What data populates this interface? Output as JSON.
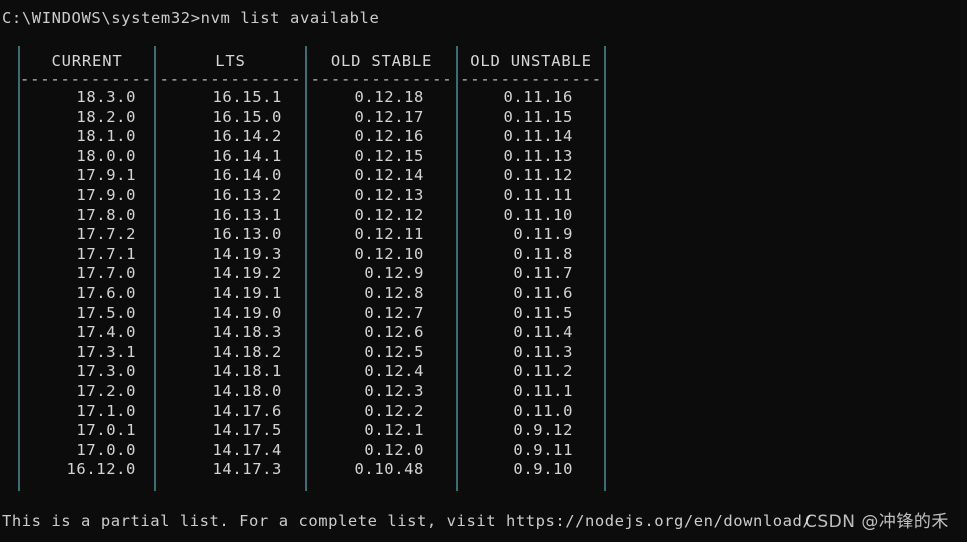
{
  "terminal": {
    "background_color": "#0c0c0c",
    "foreground_color": "#cccccc",
    "border_color": "#3a6e73",
    "prompt_line": "C:\\WINDOWS\\system32>nvm list available",
    "footer_line": "This is a partial list. For a complete list, visit https://nodejs.org/en/download/"
  },
  "table": {
    "headers": [
      "CURRENT",
      "LTS",
      "OLD STABLE",
      "OLD UNSTABLE"
    ],
    "separator": "--------------",
    "rows": [
      [
        "18.3.0",
        "16.15.1",
        "0.12.18",
        "0.11.16"
      ],
      [
        "18.2.0",
        "16.15.0",
        "0.12.17",
        "0.11.15"
      ],
      [
        "18.1.0",
        "16.14.2",
        "0.12.16",
        "0.11.14"
      ],
      [
        "18.0.0",
        "16.14.1",
        "0.12.15",
        "0.11.13"
      ],
      [
        "17.9.1",
        "16.14.0",
        "0.12.14",
        "0.11.12"
      ],
      [
        "17.9.0",
        "16.13.2",
        "0.12.13",
        "0.11.11"
      ],
      [
        "17.8.0",
        "16.13.1",
        "0.12.12",
        "0.11.10"
      ],
      [
        "17.7.2",
        "16.13.0",
        "0.12.11",
        "0.11.9"
      ],
      [
        "17.7.1",
        "14.19.3",
        "0.12.10",
        "0.11.8"
      ],
      [
        "17.7.0",
        "14.19.2",
        "0.12.9",
        "0.11.7"
      ],
      [
        "17.6.0",
        "14.19.1",
        "0.12.8",
        "0.11.6"
      ],
      [
        "17.5.0",
        "14.19.0",
        "0.12.7",
        "0.11.5"
      ],
      [
        "17.4.0",
        "14.18.3",
        "0.12.6",
        "0.11.4"
      ],
      [
        "17.3.1",
        "14.18.2",
        "0.12.5",
        "0.11.3"
      ],
      [
        "17.3.0",
        "14.18.1",
        "0.12.4",
        "0.11.2"
      ],
      [
        "17.2.0",
        "14.18.0",
        "0.12.3",
        "0.11.1"
      ],
      [
        "17.1.0",
        "14.17.6",
        "0.12.2",
        "0.11.0"
      ],
      [
        "17.0.1",
        "14.17.5",
        "0.12.1",
        "0.9.12"
      ],
      [
        "17.0.0",
        "14.17.4",
        "0.12.0",
        "0.9.11"
      ],
      [
        "16.12.0",
        "14.17.3",
        "0.10.48",
        "0.9.10"
      ]
    ]
  },
  "watermark": {
    "text": "CSDN @冲锋的禾"
  }
}
